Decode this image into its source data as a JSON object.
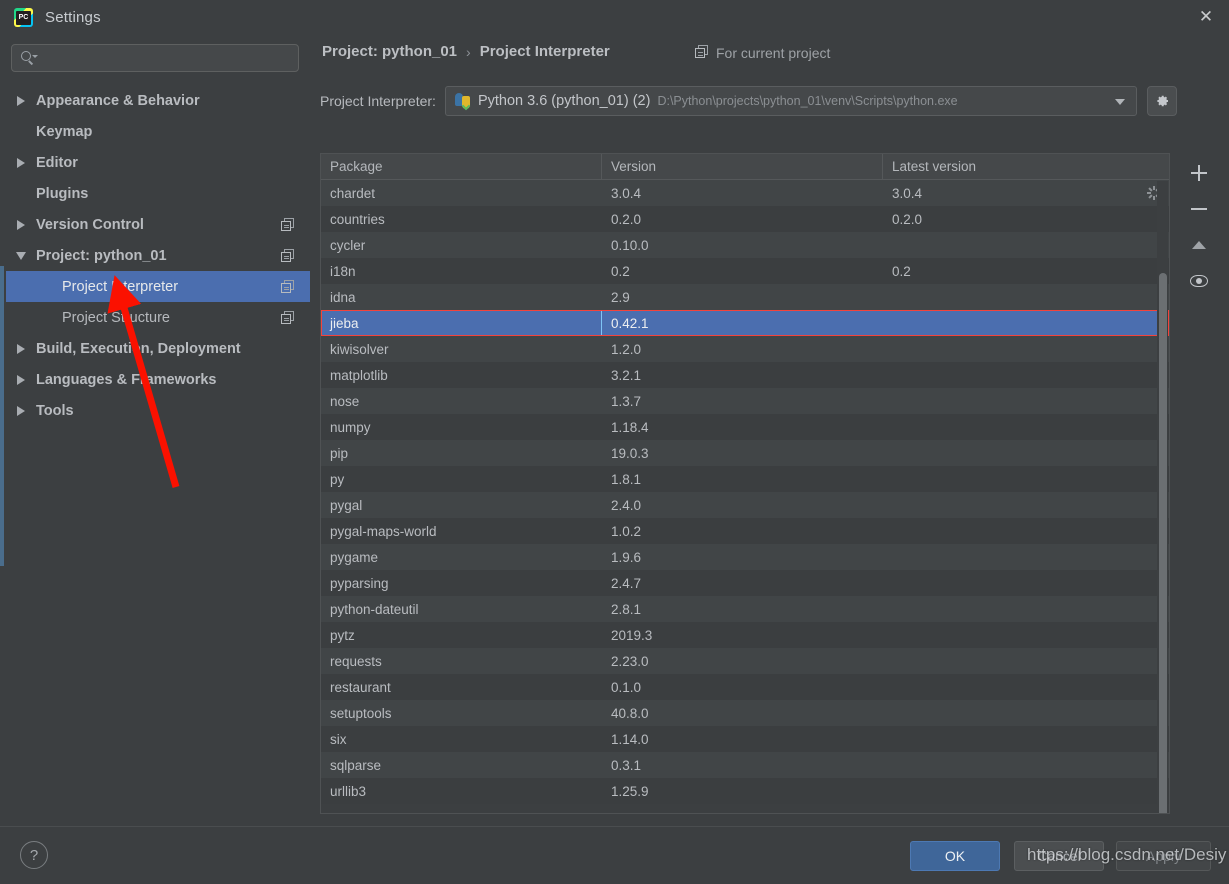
{
  "window": {
    "title": "Settings",
    "logo_icon": "pycharm-logo-icon",
    "close_icon": "close-icon"
  },
  "sidebar": {
    "search": {
      "placeholder": "",
      "value": "",
      "icon": "search-icon"
    },
    "items": [
      {
        "label": "Appearance & Behavior",
        "expander": "arrow-right",
        "bold": true,
        "indent": false,
        "selected": false,
        "copy": false
      },
      {
        "label": "Keymap",
        "expander": "none",
        "bold": true,
        "indent": false,
        "selected": false,
        "copy": false
      },
      {
        "label": "Editor",
        "expander": "arrow-right",
        "bold": true,
        "indent": false,
        "selected": false,
        "copy": false
      },
      {
        "label": "Plugins",
        "expander": "none",
        "bold": true,
        "indent": false,
        "selected": false,
        "copy": false
      },
      {
        "label": "Version Control",
        "expander": "arrow-right",
        "bold": true,
        "indent": false,
        "selected": false,
        "copy": true
      },
      {
        "label": "Project: python_01",
        "expander": "arrow-down",
        "bold": true,
        "indent": false,
        "selected": false,
        "copy": true
      },
      {
        "label": "Project Interpreter",
        "expander": "none",
        "bold": false,
        "indent": true,
        "selected": true,
        "copy": true
      },
      {
        "label": "Project Structure",
        "expander": "none",
        "bold": false,
        "indent": true,
        "selected": false,
        "copy": true
      },
      {
        "label": "Build, Execution, Deployment",
        "expander": "arrow-right",
        "bold": true,
        "indent": false,
        "selected": false,
        "copy": false
      },
      {
        "label": "Languages & Frameworks",
        "expander": "arrow-right",
        "bold": true,
        "indent": false,
        "selected": false,
        "copy": false
      },
      {
        "label": "Tools",
        "expander": "arrow-right",
        "bold": true,
        "indent": false,
        "selected": false,
        "copy": false
      }
    ]
  },
  "header": {
    "breadcrumb_root": "Project: python_01",
    "breadcrumb_sep": "›",
    "breadcrumb_leaf": "Project Interpreter",
    "for_current_project": "For current project",
    "for_current_icon": "copy-scope-icon"
  },
  "interpreter": {
    "label": "Project Interpreter:",
    "icon": "python-venv-icon",
    "name": "Python 3.6 (python_01) (2)",
    "path": "D:\\Python\\projects\\python_01\\venv\\Scripts\\python.exe",
    "dropdown_icon": "chevron-down-icon",
    "settings_icon": "gear-icon"
  },
  "packages_table": {
    "columns": [
      "Package",
      "Version",
      "Latest version"
    ],
    "rows": [
      {
        "package": "chardet",
        "version": "3.0.4",
        "latest": "3.0.4",
        "selected": false,
        "spinner": true
      },
      {
        "package": "countries",
        "version": "0.2.0",
        "latest": "0.2.0",
        "selected": false,
        "spinner": false
      },
      {
        "package": "cycler",
        "version": "0.10.0",
        "latest": "",
        "selected": false,
        "spinner": false
      },
      {
        "package": "i18n",
        "version": "0.2",
        "latest": "0.2",
        "selected": false,
        "spinner": false
      },
      {
        "package": "idna",
        "version": "2.9",
        "latest": "",
        "selected": false,
        "spinner": false
      },
      {
        "package": "jieba",
        "version": "0.42.1",
        "latest": "",
        "selected": true,
        "spinner": false
      },
      {
        "package": "kiwisolver",
        "version": "1.2.0",
        "latest": "",
        "selected": false,
        "spinner": false
      },
      {
        "package": "matplotlib",
        "version": "3.2.1",
        "latest": "",
        "selected": false,
        "spinner": false
      },
      {
        "package": "nose",
        "version": "1.3.7",
        "latest": "",
        "selected": false,
        "spinner": false
      },
      {
        "package": "numpy",
        "version": "1.18.4",
        "latest": "",
        "selected": false,
        "spinner": false
      },
      {
        "package": "pip",
        "version": "19.0.3",
        "latest": "",
        "selected": false,
        "spinner": false
      },
      {
        "package": "py",
        "version": "1.8.1",
        "latest": "",
        "selected": false,
        "spinner": false
      },
      {
        "package": "pygal",
        "version": "2.4.0",
        "latest": "",
        "selected": false,
        "spinner": false
      },
      {
        "package": "pygal-maps-world",
        "version": "1.0.2",
        "latest": "",
        "selected": false,
        "spinner": false
      },
      {
        "package": "pygame",
        "version": "1.9.6",
        "latest": "",
        "selected": false,
        "spinner": false
      },
      {
        "package": "pyparsing",
        "version": "2.4.7",
        "latest": "",
        "selected": false,
        "spinner": false
      },
      {
        "package": "python-dateutil",
        "version": "2.8.1",
        "latest": "",
        "selected": false,
        "spinner": false
      },
      {
        "package": "pytz",
        "version": "2019.3",
        "latest": "",
        "selected": false,
        "spinner": false
      },
      {
        "package": "requests",
        "version": "2.23.0",
        "latest": "",
        "selected": false,
        "spinner": false
      },
      {
        "package": "restaurant",
        "version": "0.1.0",
        "latest": "",
        "selected": false,
        "spinner": false
      },
      {
        "package": "setuptools",
        "version": "40.8.0",
        "latest": "",
        "selected": false,
        "spinner": false
      },
      {
        "package": "six",
        "version": "1.14.0",
        "latest": "",
        "selected": false,
        "spinner": false
      },
      {
        "package": "sqlparse",
        "version": "0.3.1",
        "latest": "",
        "selected": false,
        "spinner": false
      },
      {
        "package": "urllib3",
        "version": "1.25.9",
        "latest": "",
        "selected": false,
        "spinner": false
      }
    ]
  },
  "tools": [
    {
      "name": "add-package-button",
      "icon": "plus-icon"
    },
    {
      "name": "remove-package-button",
      "icon": "minus-icon"
    },
    {
      "name": "upgrade-package-button",
      "icon": "triangle-up-icon"
    },
    {
      "name": "show-early-releases-button",
      "icon": "eye-icon"
    }
  ],
  "footer": {
    "help_label": "?",
    "ok_label": "OK",
    "cancel_label": "Cancel",
    "apply_label": "Apply"
  },
  "watermark": {
    "text": "https://blog.csdn.net/Desiy"
  },
  "annotation": {
    "arrow_color": "#fb1100"
  },
  "colors": {
    "background": "#3c3f41",
    "selection": "#4b6eaf",
    "selection_outline": "#f4433c",
    "ok_button": "#3f6699"
  }
}
